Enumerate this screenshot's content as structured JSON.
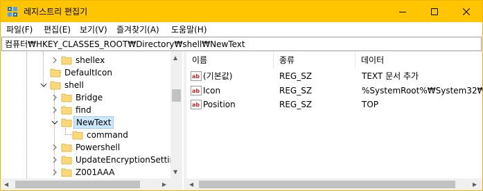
{
  "window": {
    "title": "레지스트리 편집기",
    "accent_color": "#ffc500",
    "controls": {
      "minimize_icon": "minimize-icon",
      "maximize_icon": "maximize-icon",
      "close_icon": "close-icon"
    }
  },
  "menu": [
    "파일(F)",
    "편집(E)",
    "보기(V)",
    "즐겨찾기(A)",
    "도움말(H)"
  ],
  "address": "컴퓨터₩HKEY_CLASSES_ROOT₩Directory₩shell₩NewText",
  "tree": {
    "items": [
      {
        "label": "shellex",
        "expander": "right"
      },
      {
        "label": "DefaultIcon",
        "expander": "none"
      },
      {
        "label": "shell",
        "expander": "down"
      },
      {
        "label": "Bridge",
        "expander": "right"
      },
      {
        "label": "find",
        "expander": "right"
      },
      {
        "label": "NewText",
        "expander": "down",
        "selected": true
      },
      {
        "label": "command",
        "expander": "none"
      },
      {
        "label": "Powershell",
        "expander": "right"
      },
      {
        "label": "UpdateEncryptionSetting",
        "expander": "right"
      },
      {
        "label": "Z001AAA",
        "expander": "right"
      }
    ]
  },
  "list": {
    "columns": [
      "이름",
      "종류",
      "데이터"
    ],
    "rows": [
      {
        "name": "(기본값)",
        "type": "REG_SZ",
        "data": "TEXT 문서 추가"
      },
      {
        "name": "Icon",
        "type": "REG_SZ",
        "data": "%SystemRoot%₩System32₩"
      },
      {
        "name": "Position",
        "type": "REG_SZ",
        "data": "TOP"
      }
    ]
  }
}
